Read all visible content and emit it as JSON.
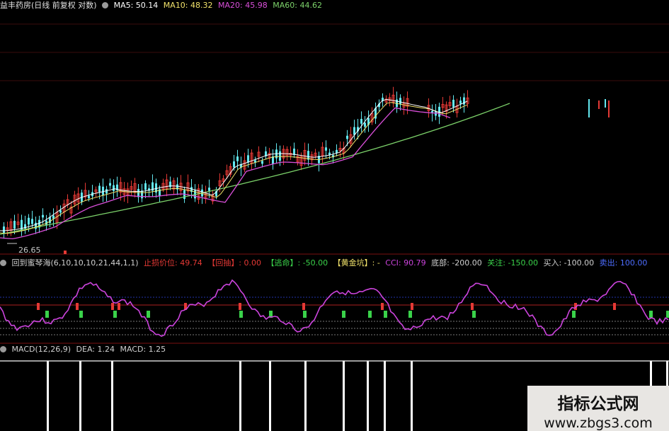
{
  "price_panel": {
    "title": "益丰药房(日线 前复权 对数)",
    "ma5": "MA5: 50.14",
    "ma10": "MA10: 48.32",
    "ma20": "MA20: 45.98",
    "ma60": "MA60: 44.62",
    "low_label": "26.65",
    "colors": {
      "ma5": "#ffffff",
      "ma10": "#f2e36b",
      "ma20": "#d94fd9",
      "ma60": "#7cd26a",
      "up": "#e53935",
      "down": "#63e8f0"
    }
  },
  "indicator_panel": {
    "name": "回到蜜琴海",
    "params": "(6,10,10,10,21,44,1,1)",
    "stop_price": "止损价位: 49.74",
    "pullback": "【回抽】: 0.00",
    "escape": "【逃命】: -50.00",
    "golden_pit": "【黄金坑】: -",
    "cci": "CCI: 90.79",
    "bottom": "底部: -200.00",
    "watch": "关注: -150.00",
    "buy": "买入: -100.00",
    "sell": "卖出: 100.00",
    "colors": {
      "line": "#cc44dd",
      "red": "#e53935",
      "green": "#3ad24a"
    }
  },
  "macd_panel": {
    "name": "MACD(12,26,9)",
    "dea": "DEA: 1.24",
    "macd": "MACD: 1.25"
  },
  "watermark": {
    "line1": "指标公式网",
    "line2": "www.zbgs3.com"
  }
}
